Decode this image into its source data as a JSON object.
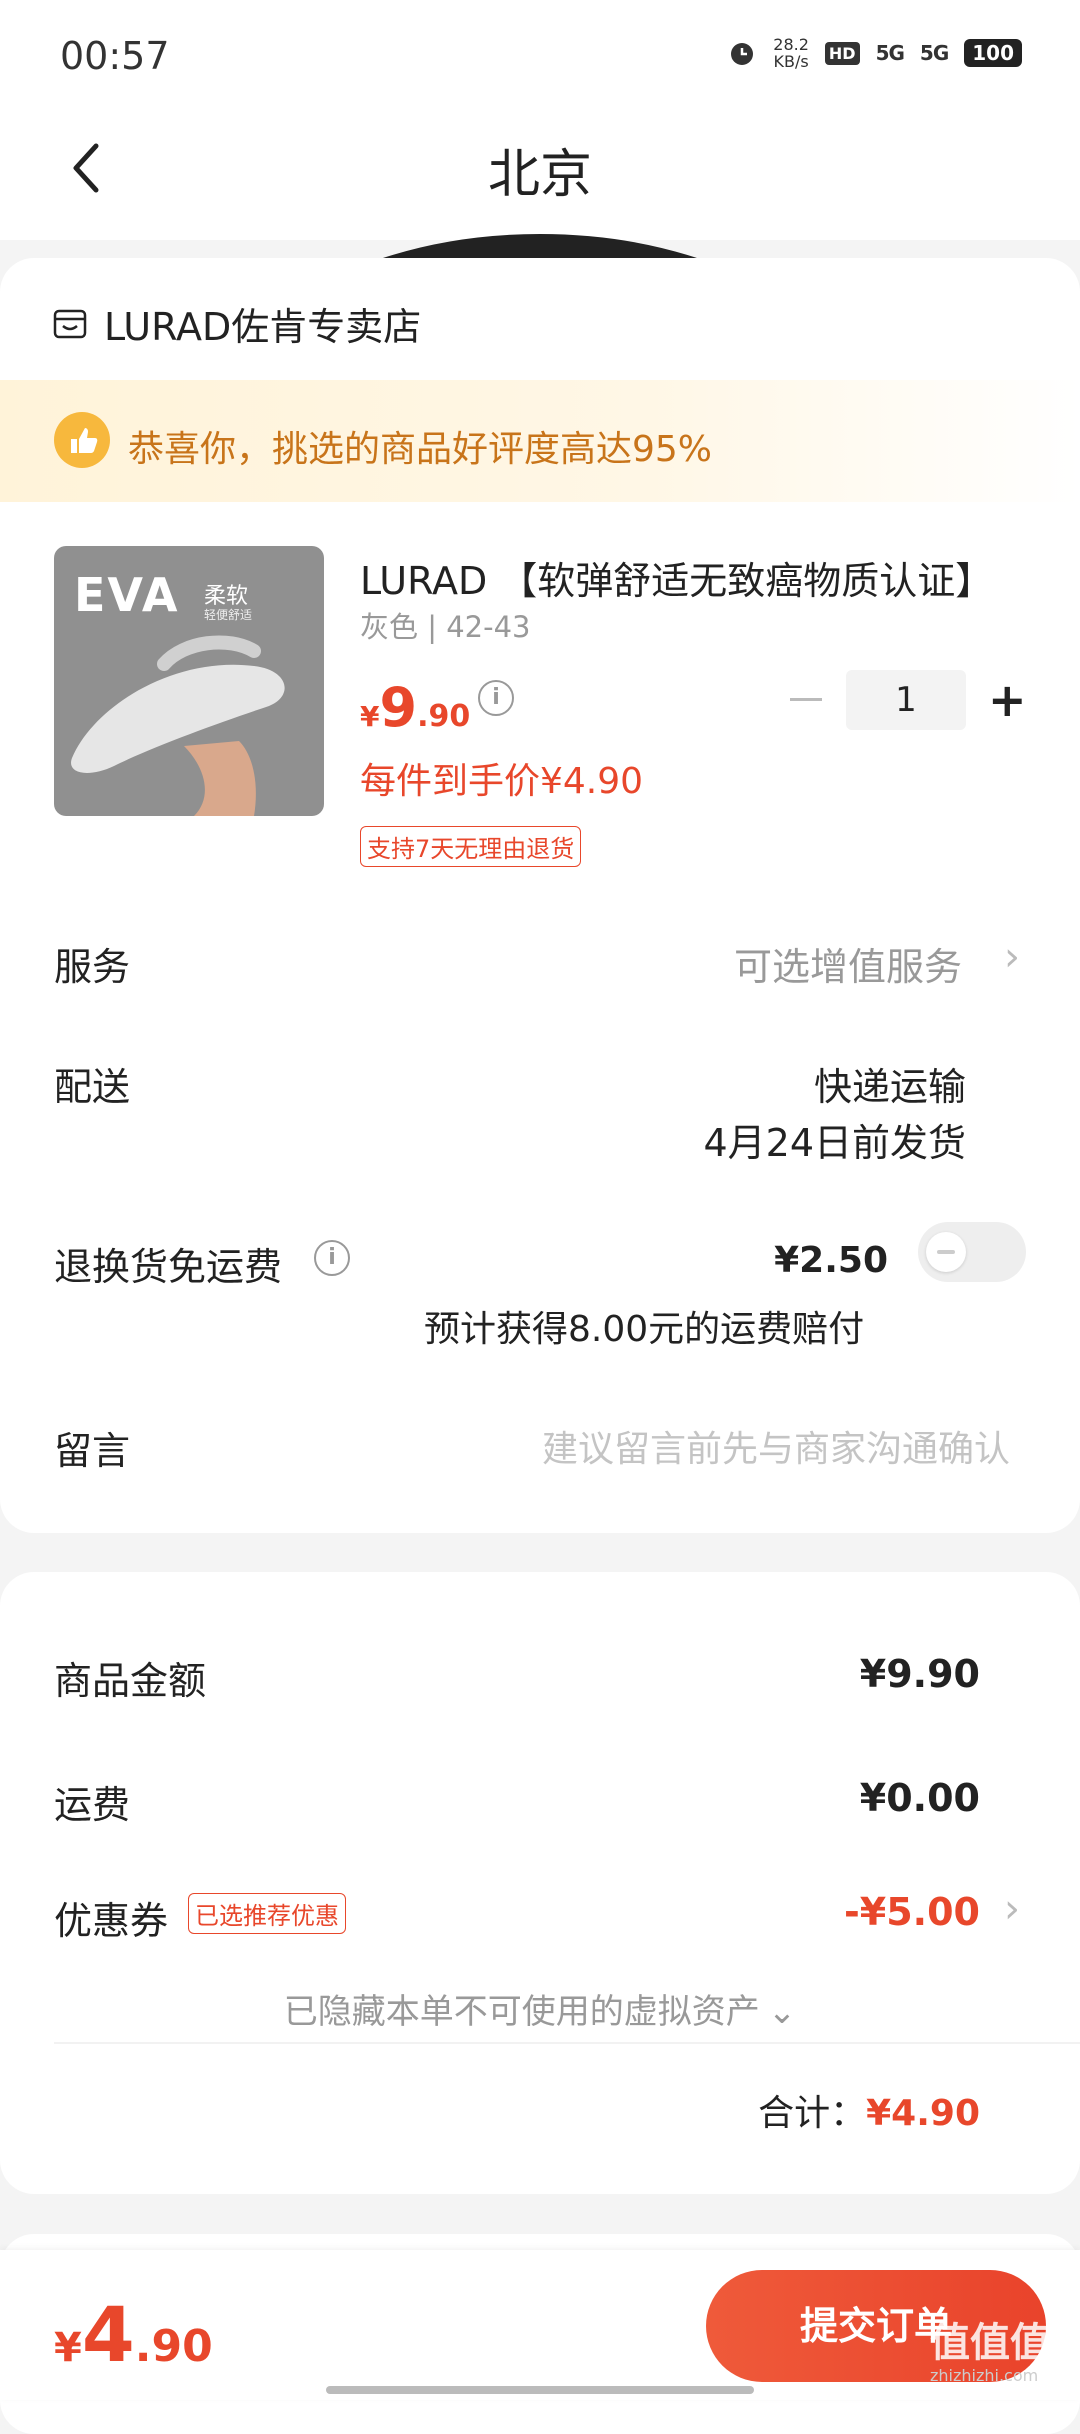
{
  "status_bar": {
    "time": "00:57",
    "speed_value": "28.2",
    "speed_unit": "KB/s",
    "hd": "HD",
    "sim_index": "1 2",
    "signal1": "5G",
    "signal2": "5G",
    "battery": "100"
  },
  "header": {
    "title": "北京"
  },
  "store": {
    "name": "LURAD佐肯专卖店"
  },
  "banner": {
    "text": "恭喜你，挑选的商品好评度高达95%"
  },
  "product": {
    "thumb_eva": "EVA",
    "thumb_soft": "柔软",
    "thumb_soft_sub": "轻便舒适",
    "title": "LURAD 【软弹舒适无致癌物质认证】",
    "spec": "灰色 | 42-43",
    "price_currency": "¥",
    "price_int": "9",
    "price_dec": ".90",
    "per_unit": "每件到手价¥4.90",
    "return_tag": "支持7天无理由退货",
    "quantity": "1"
  },
  "rows": {
    "service_label": "服务",
    "service_value": "可选增值服务",
    "delivery_label": "配送",
    "delivery_method": "快递运输",
    "delivery_date": "4月24日前发货",
    "return_label": "退换货免运费",
    "return_price": "¥2.50",
    "return_note": "预计获得8.00元的运费赔付",
    "message_label": "留言",
    "message_placeholder": "建议留言前先与商家沟通确认"
  },
  "summary": {
    "goods_label": "商品金额",
    "goods_value": "¥9.90",
    "shipping_label": "运费",
    "shipping_value": "¥0.00",
    "coupon_label": "优惠券",
    "coupon_tag": "已选推荐优惠",
    "coupon_value": "-¥5.00",
    "hidden_assets": "已隐藏本单不可使用的虚拟资产",
    "total_label": "合计：",
    "total_value": "¥4.90"
  },
  "bottom": {
    "currency": "¥",
    "price_int": "4",
    "price_dec": ".90",
    "submit_label": "提交订单",
    "watermark": "值值值",
    "watermark_sub": "zhizhizhi.com"
  },
  "colors": {
    "accent": "#e8472b",
    "banner_text": "#c8741a",
    "banner_bg": "#fff3d9"
  }
}
